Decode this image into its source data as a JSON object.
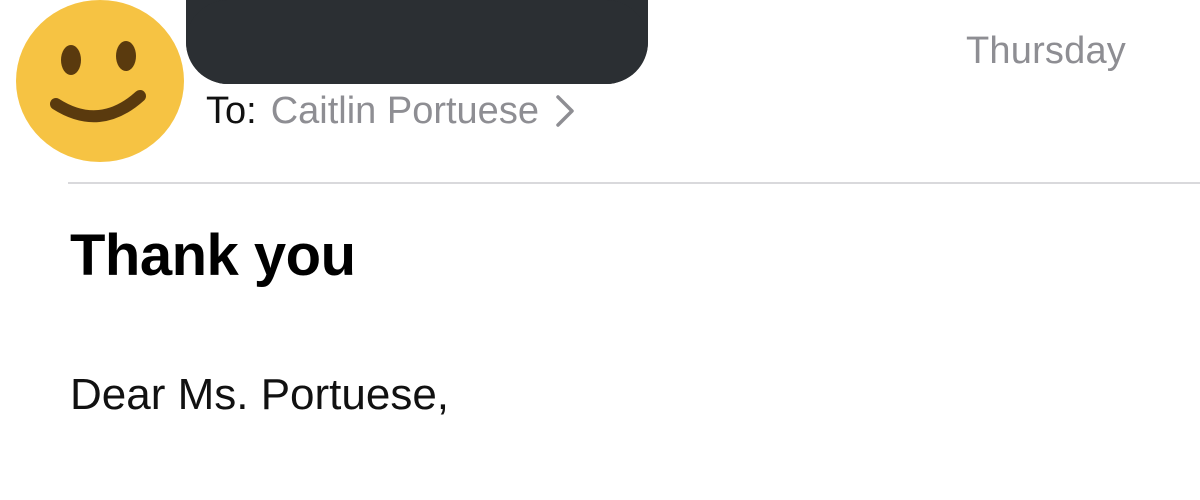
{
  "header": {
    "avatar_icon": "smiley-face-icon",
    "sender_redacted": true,
    "date": "Thursday",
    "to_label": "To:",
    "recipient_name": "Caitlin Portuese",
    "recipient_chevron_icon": "chevron-right-icon"
  },
  "message": {
    "subject": "Thank you",
    "body_first_line": "Dear Ms. Portuese,"
  },
  "colors": {
    "avatar_face": "#F6C343",
    "avatar_features": "#5A3A0E",
    "redaction": "#2B2F33",
    "secondary_text": "#8E8E93",
    "divider": "#D9D9DC"
  }
}
